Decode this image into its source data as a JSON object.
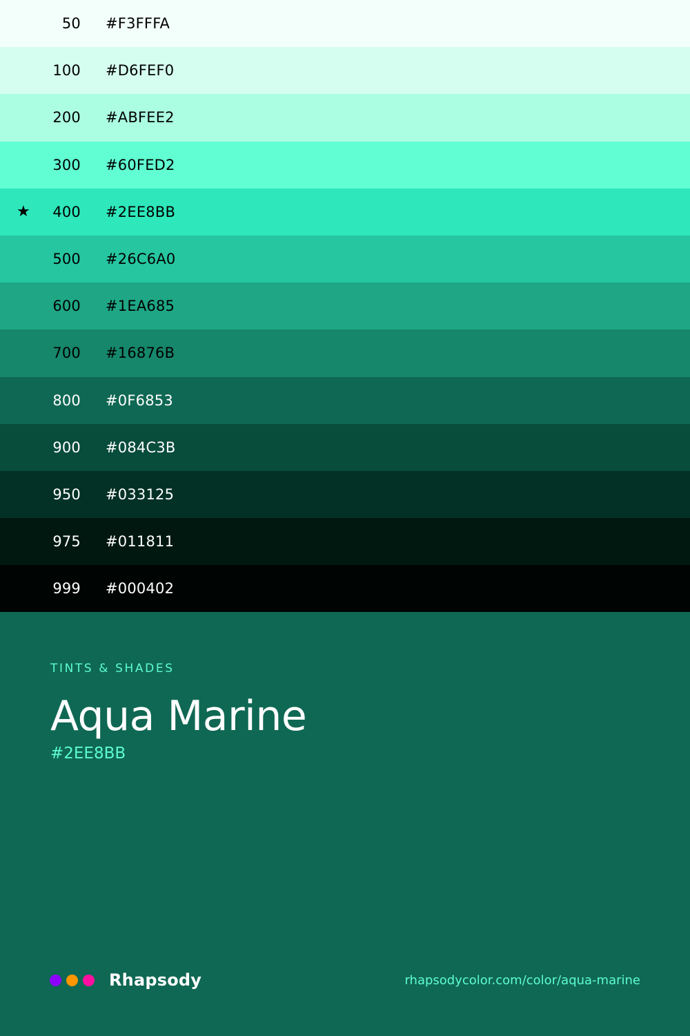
{
  "swatches": [
    {
      "level": "50",
      "hex": "#F3FFFA",
      "text_color": "#000000",
      "star": ""
    },
    {
      "level": "100",
      "hex": "#D6FEF0",
      "text_color": "#000000",
      "star": ""
    },
    {
      "level": "200",
      "hex": "#ABFEE2",
      "text_color": "#000000",
      "star": ""
    },
    {
      "level": "300",
      "hex": "#60FED2",
      "text_color": "#000000",
      "star": ""
    },
    {
      "level": "400",
      "hex": "#2EE8BB",
      "text_color": "#000000",
      "star": "★"
    },
    {
      "level": "500",
      "hex": "#26C6A0",
      "text_color": "#000000",
      "star": ""
    },
    {
      "level": "600",
      "hex": "#1EA685",
      "text_color": "#000000",
      "star": ""
    },
    {
      "level": "700",
      "hex": "#16876B",
      "text_color": "#000000",
      "star": ""
    },
    {
      "level": "800",
      "hex": "#0F6853",
      "text_color": "#ffffff",
      "star": ""
    },
    {
      "level": "900",
      "hex": "#084C3B",
      "text_color": "#ffffff",
      "star": ""
    },
    {
      "level": "950",
      "hex": "#033125",
      "text_color": "#ffffff",
      "star": ""
    },
    {
      "level": "975",
      "hex": "#011811",
      "text_color": "#ffffff",
      "star": ""
    },
    {
      "level": "999",
      "hex": "#000402",
      "text_color": "#ffffff",
      "star": ""
    }
  ],
  "info": {
    "eyebrow": "TINTS & SHADES",
    "name": "Aqua Marine",
    "hex": "#2EE8BB"
  },
  "footer": {
    "brand": "Rhapsody",
    "brand_dots": [
      "#8B00FF",
      "#FF9500",
      "#FF0F9F"
    ],
    "url": "rhapsodycolor.com/color/aqua-marine"
  },
  "colors": {
    "background": "#0F6853",
    "accent": "#5EFCD2"
  }
}
